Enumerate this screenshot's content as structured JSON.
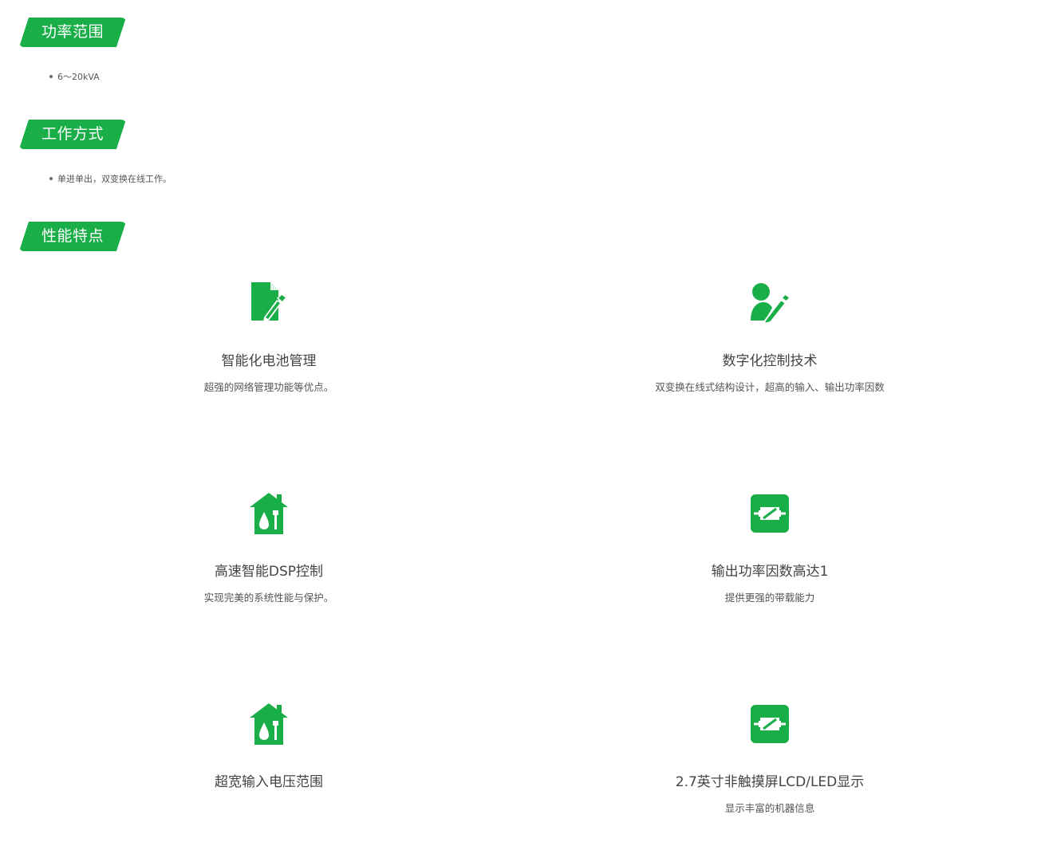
{
  "sections": {
    "power": {
      "heading": "功率范围",
      "items": [
        "6～20kVA"
      ]
    },
    "mode": {
      "heading": "工作方式",
      "items": [
        "单进单出，双变换在线工作。"
      ]
    },
    "features": {
      "heading": "性能特点"
    }
  },
  "feature_items": [
    {
      "icon": "document-edit-icon",
      "title": "智能化电池管理",
      "desc": "超强的网络管理功能等优点。"
    },
    {
      "icon": "user-edit-icon",
      "title": "数字化控制技术",
      "desc": "双变换在线式结构设计，超高的输入、输出功率因数"
    },
    {
      "icon": "house-tools-icon",
      "title": "高速智能DSP控制",
      "desc": "实现完美的系统性能与保护。"
    },
    {
      "icon": "circuit-board-icon",
      "title": "输出功率因数高达1",
      "desc": "提供更强的带载能力"
    },
    {
      "icon": "house-tools-icon",
      "title": "超宽输入电压范围",
      "desc": ""
    },
    {
      "icon": "circuit-board-icon",
      "title": "2.7英寸非触摸屏LCD/LED显示",
      "desc": "显示丰富的机器信息"
    }
  ],
  "colors": {
    "accent": "#1aae48",
    "text": "#444444"
  }
}
